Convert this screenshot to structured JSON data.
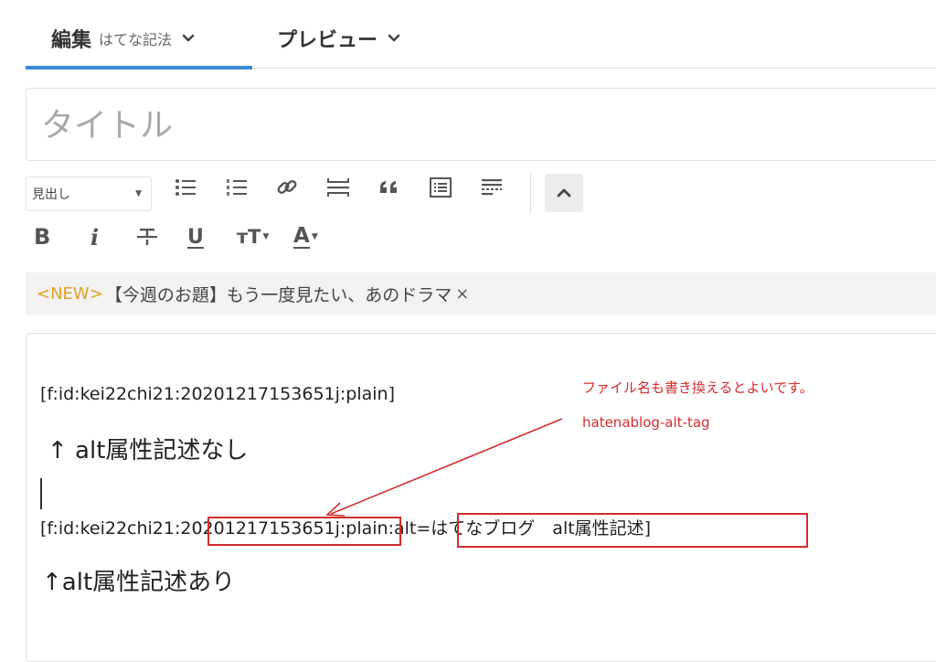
{
  "tabs": {
    "edit": {
      "label": "編集",
      "sub_label": "はてな記法"
    },
    "preview": {
      "label": "プレビュー"
    }
  },
  "title_input": {
    "placeholder": "タイトル",
    "value": ""
  },
  "toolbar": {
    "heading_select": {
      "selected": "見出し"
    },
    "row1_icons": [
      "unordered-list-icon",
      "ordered-list-icon",
      "link-icon",
      "horizontal-rule-icon",
      "blockquote-icon",
      "table-of-contents-icon",
      "read-more-icon"
    ],
    "collapse_icon": "chevron-up-icon",
    "formatting": {
      "bold": "B",
      "italic": "i",
      "underline": "U",
      "font_size": "тT",
      "text_color": "A"
    }
  },
  "notice": {
    "badge": "<NEW>",
    "text": "【今週のお題】もう一度見たい、あのドラマ",
    "close": "×"
  },
  "editor": {
    "lines": [
      "[f:id:kei22chi21:20201217153651j:plain]",
      "↑ alt属性記述なし",
      "[f:id:kei22chi21:20201217153651j:plain:alt=はてなブログ　alt属性記述]",
      "↑alt属性記述あり"
    ]
  },
  "annotations": {
    "note": "ファイル名も書き換えるとよいです。",
    "filename_suggestion": "hatenablog-alt-tag",
    "color": "#d42c2c"
  },
  "colors": {
    "accent": "#3a8ad6",
    "new_badge": "#e0a020"
  }
}
